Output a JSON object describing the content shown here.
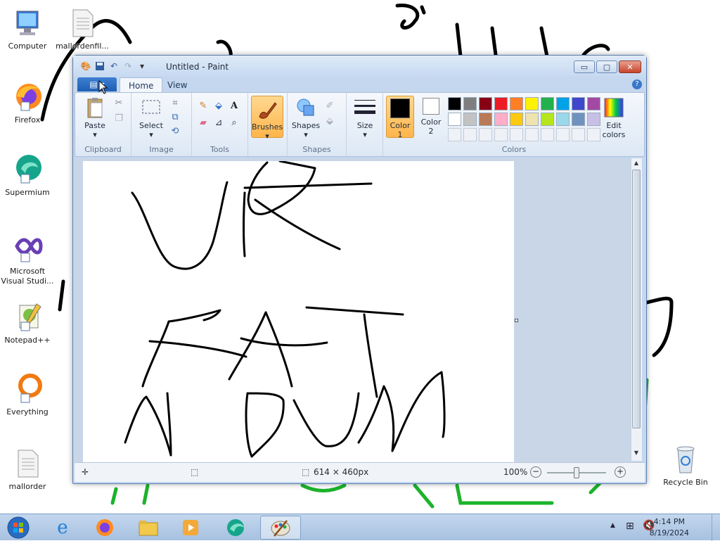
{
  "desktop": {
    "icons": [
      {
        "label": "Computer",
        "icon": "computer-icon"
      },
      {
        "label": "mallordenfil...",
        "icon": "text-file-icon"
      },
      {
        "label": "Firefox",
        "icon": "firefox-icon"
      },
      {
        "label": "Supermium",
        "icon": "supermium-icon"
      },
      {
        "label": "Microsoft Visual Studi...",
        "icon": "visual-studio-icon"
      },
      {
        "label": "Notepad++",
        "icon": "notepadpp-icon"
      },
      {
        "label": "Everything",
        "icon": "everything-icon"
      },
      {
        "label": "mallorder",
        "icon": "text-file-icon"
      },
      {
        "label": "Recycle Bin",
        "icon": "recycle-bin-icon"
      }
    ]
  },
  "window": {
    "title": "Untitled - Paint",
    "controls": {
      "minimize": "▭",
      "maximize": "▢",
      "close": "✕"
    },
    "tabs": {
      "file": "▤ ▾",
      "home": "Home",
      "view": "View",
      "help": "?"
    }
  },
  "ribbon": {
    "clipboard": {
      "label": "Clipboard",
      "paste": "Paste"
    },
    "image": {
      "label": "Image",
      "select": "Select"
    },
    "tools": {
      "label": "Tools"
    },
    "brushes": {
      "label": "Brushes"
    },
    "shapes": {
      "label": "Shapes",
      "button": "Shapes"
    },
    "size": {
      "label": "Size"
    },
    "colors": {
      "label": "Colors",
      "color1": "Color\n1",
      "color1_line1": "Color",
      "color1_line2": "1",
      "color2_line1": "Color",
      "color2_line2": "2",
      "edit_line1": "Edit",
      "edit_line2": "colors",
      "color1_value": "#000000",
      "color2_value": "#ffffff",
      "palette": [
        [
          "#000000",
          "#7f7f7f",
          "#880015",
          "#ed1c24",
          "#ff7f27",
          "#fff200",
          "#22b14c",
          "#00a2e8",
          "#3f48cc",
          "#a349a4"
        ],
        [
          "#ffffff",
          "#c3c3c3",
          "#b97a57",
          "#ffaec9",
          "#ffc90e",
          "#efe4b0",
          "#b5e61d",
          "#99d9ea",
          "#7092be",
          "#c8bfe7"
        ]
      ]
    }
  },
  "status": {
    "dimensions": "614 × 460px",
    "zoom": "100%"
  },
  "taskbar": {
    "time": "4:14 PM",
    "date": "8/19/2024"
  }
}
